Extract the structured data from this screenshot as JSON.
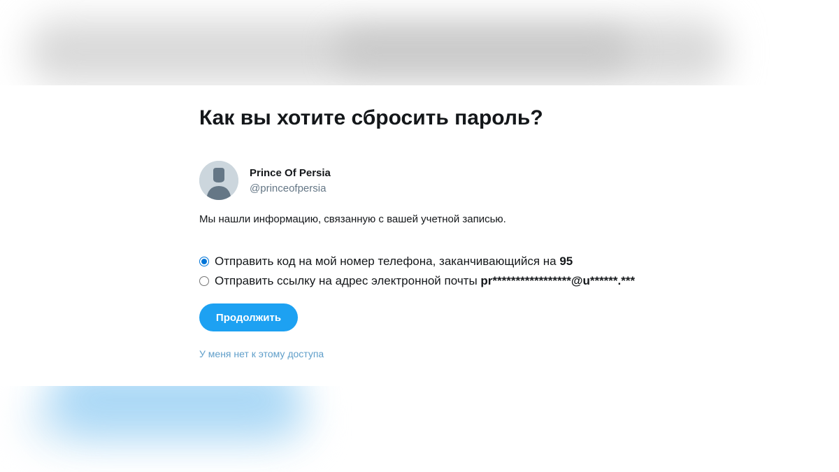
{
  "page": {
    "title": "Как вы хотите сбросить пароль?"
  },
  "account": {
    "name": "Prince Of Persia",
    "handle": "@princeofpersia",
    "avatar_icon": "default-avatar-icon"
  },
  "info_text": "Мы нашли информацию, связанную с вашей учетной записью.",
  "options": [
    {
      "label": "Отправить код на мой номер телефона, заканчивающийся на ",
      "bold": "95",
      "selected": true
    },
    {
      "label": "Отправить ссылку на адрес электронной почты ",
      "bold": "pr*****************@u******.***",
      "selected": false
    }
  ],
  "continue_button": "Продолжить",
  "no_access_link": "У меня нет к этому доступа",
  "colors": {
    "accent": "#1da1f2",
    "radio_checked": "#0075d8",
    "link": "#5f9ec9",
    "text": "#14171a",
    "secondary_text": "#657786",
    "avatar_bg": "#ccd6dd"
  }
}
